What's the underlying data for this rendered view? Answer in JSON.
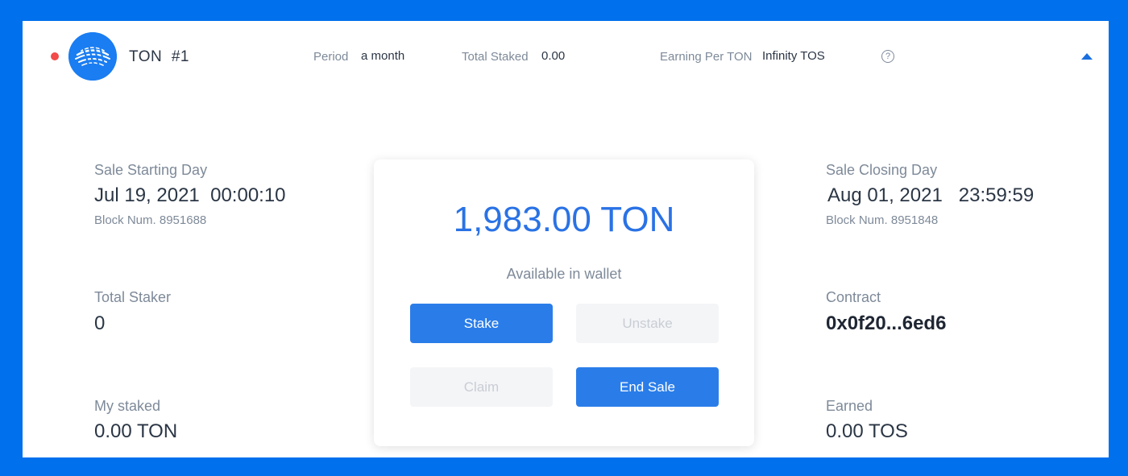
{
  "header": {
    "token_name": "TON  #1",
    "period_label": "Period",
    "period_value": "a month",
    "total_staked_label": "Total Staked",
    "total_staked_value": "0.00",
    "earning_label": "Earning Per TON",
    "earning_value": "Infinity TOS",
    "help_icon": "question-circle-icon",
    "collapse_icon": "caret-up-icon",
    "status_color": "#F34A4A"
  },
  "left": {
    "start_label": "Sale Starting Day",
    "start_value": "Jul 19, 2021  00:00:10",
    "start_block": "Block Num. 8951688",
    "stakers_label": "Total Staker",
    "stakers_value": "0",
    "my_staked_label": "My staked",
    "my_staked_value": "0.00 TON"
  },
  "center": {
    "balance": "1,983.00 TON",
    "balance_caption": "Available in wallet",
    "stake_label": "Stake",
    "unstake_label": "Unstake",
    "claim_label": "Claim",
    "end_sale_label": "End Sale"
  },
  "right": {
    "close_label": "Sale Closing Day",
    "close_value": "Aug 01, 2021   23:59:59",
    "close_block": "Block Num. 8951848",
    "contract_label": "Contract",
    "contract_value": "0x0f20...6ed6",
    "earned_label": "Earned",
    "earned_value": "0.00 TOS"
  },
  "colors": {
    "background": "#0070ED",
    "accent": "#2A7DE9",
    "balance": "#2A72E5"
  }
}
